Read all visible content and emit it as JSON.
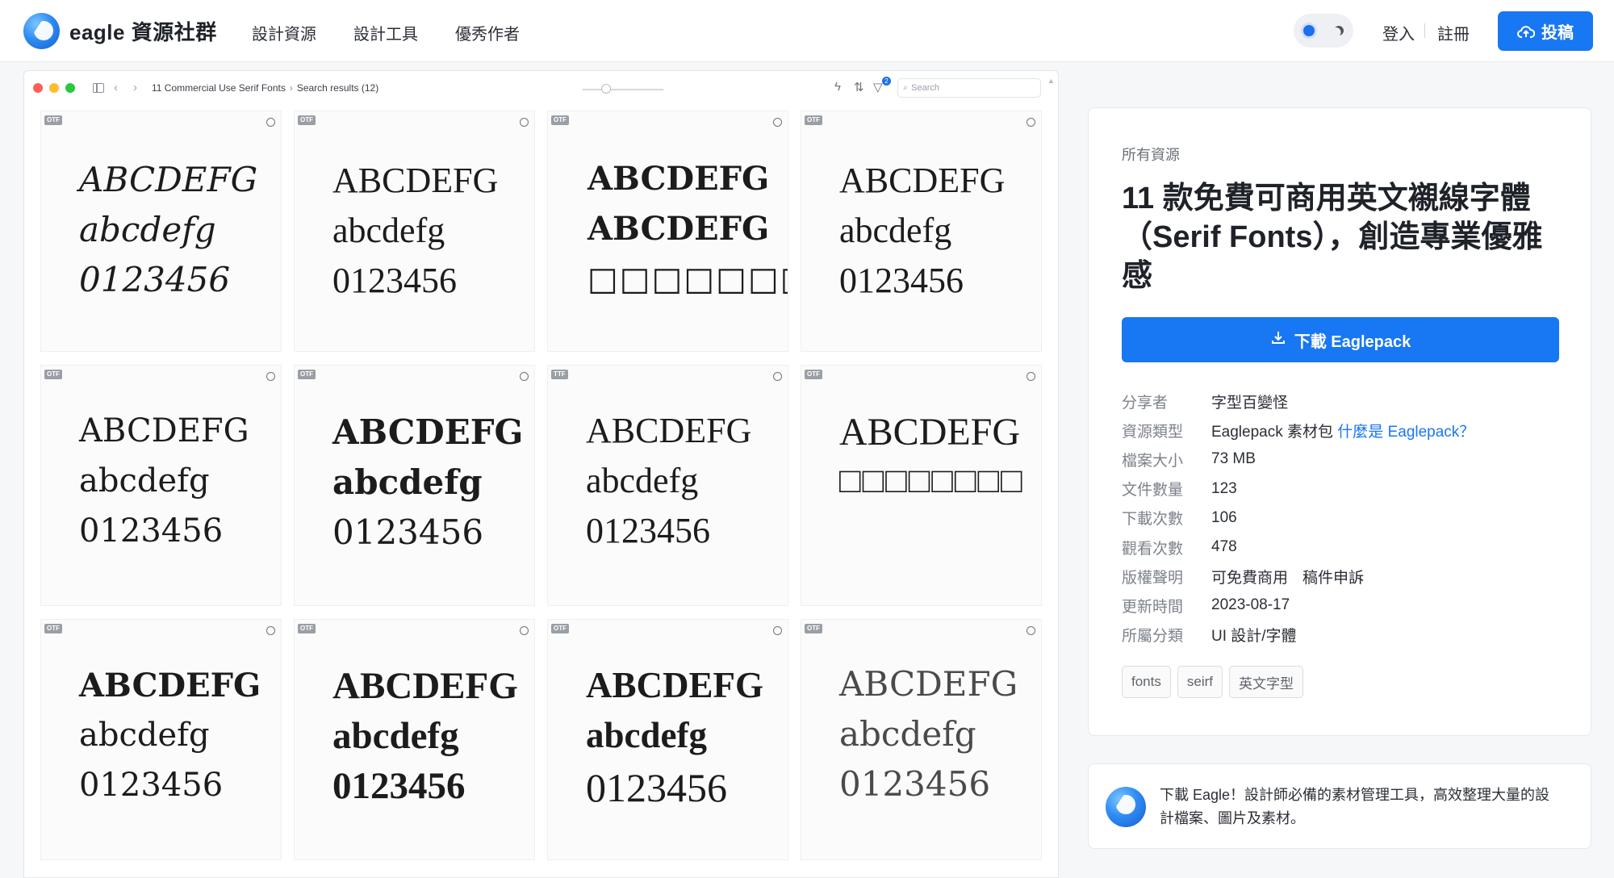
{
  "header": {
    "brand": "eagle 資源社群",
    "nav": [
      "設計資源",
      "設計工具",
      "優秀作者"
    ],
    "login": "登入",
    "register": "註冊",
    "submit": "投稿"
  },
  "preview": {
    "breadcrumb": [
      "11 Commercial Use Serif Fonts",
      "Search results (12)"
    ],
    "filter_count": "2",
    "search_placeholder": "Search",
    "cells": [
      {
        "badge": "OTF",
        "lines": [
          "ABCDEFG",
          "abcdefg",
          "0123456"
        ]
      },
      {
        "badge": "OTF",
        "lines": [
          "ABCDEFG",
          "abcdefg",
          "0123456"
        ]
      },
      {
        "badge": "OTF",
        "lines": [
          "ABCDEFG",
          "ABCDEFG",
          "□□□□□□□□"
        ]
      },
      {
        "badge": "OTF",
        "lines": [
          "ABCDEFG",
          "abcdefg",
          "0123456"
        ]
      },
      {
        "badge": "OTF",
        "lines": [
          "ABCDEFG",
          "abcdefg",
          "0123456"
        ]
      },
      {
        "badge": "OTF",
        "lines": [
          "ABCDEFG",
          "abcdefg",
          "0123456"
        ]
      },
      {
        "badge": "TTF",
        "lines": [
          "ABCDEFG",
          "abcdefg",
          "0123456"
        ]
      },
      {
        "badge": "OTF",
        "lines": [
          "ABCDEFG",
          "□□□□□□□□",
          ""
        ]
      },
      {
        "badge": "OTF",
        "lines": [
          "ABCDEFG",
          "abcdefg",
          "0123456"
        ]
      },
      {
        "badge": "OTF",
        "lines": [
          "ABCDEFG",
          "abcdefg",
          "0123456"
        ]
      },
      {
        "badge": "OTF",
        "lines": [
          "ABCDEFG",
          "abcdefg",
          "0123456"
        ]
      },
      {
        "badge": "OTF",
        "lines": [
          "ABCDEFG",
          "abcdefg",
          "0123456"
        ]
      }
    ]
  },
  "detail": {
    "category": "所有資源",
    "title": "11 款免費可商用英文襯線字體（Serif Fonts），創造專業優雅感",
    "download_label": "下載 Eaglepack",
    "meta": [
      {
        "k": "分享者",
        "v": "字型百變怪"
      },
      {
        "k": "資源類型",
        "v": "Eaglepack 素材包",
        "link": "什麼是 Eaglepack？"
      },
      {
        "k": "檔案大小",
        "v": "73 MB"
      },
      {
        "k": "文件數量",
        "v": "123"
      },
      {
        "k": "下載次數",
        "v": "106"
      },
      {
        "k": "觀看次數",
        "v": "478"
      },
      {
        "k": "版權聲明",
        "v": "可免費商用",
        "v2": "稿件申訴"
      },
      {
        "k": "更新時間",
        "v": "2023-08-17"
      },
      {
        "k": "所屬分類",
        "v": "UI 設計/字體"
      }
    ],
    "tags": [
      "fonts",
      "seirf",
      "英文字型"
    ]
  },
  "promo": {
    "text": "下載 Eagle！設計師必備的素材管理工具，高效整理大量的設計檔案、圖片及素材。"
  },
  "colors": {
    "accent": "#1877f2",
    "badge": "#9a9ea5"
  }
}
